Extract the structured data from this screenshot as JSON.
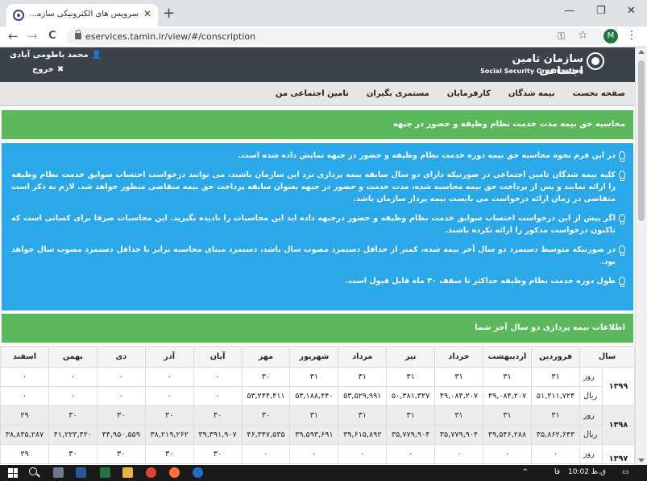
{
  "browser": {
    "tab_title": "سرویس های الکترونیکی سازمان تام",
    "tab_close": "✕",
    "new_tab": "+",
    "win_min": "—",
    "win_max": "❐",
    "win_close": "✕",
    "nav_back": "←",
    "nav_forward": "→",
    "nav_reload": "C",
    "url": "eservices.tamin.ir/view/#/conscription",
    "key": "⚿",
    "star": "☆",
    "profile_initial": "M",
    "menu": "⋮"
  },
  "header": {
    "logo_fa": "سازمان تامین اجتماعی",
    "logo_en": "Social Security Organization",
    "user_name": "محمد باطومی آبادی",
    "user_icon": "👤",
    "logout_label": "خروج",
    "logout_icon": "✖"
  },
  "nav": {
    "items": [
      "صفحه نخست",
      "بیمه شدگان",
      "کارفرمایان",
      "مستمری بگیران",
      "تامین اجتماعی من"
    ]
  },
  "calc_header": "محاسبه حق بیمه مدت خدمت نظام وظیفه و حضور در جبهه",
  "info": {
    "items": [
      "در این فرم نحوه محاسبه حق بیمه دوره خدمت نظام وظیفه و حضور در جبهه نمایش داده شده است.",
      "کلیه بیمه شدگان تامین اجتماعی در صورتیکه دارای دو سال سابقه بیمه پردازی نزد این سازمان باشند، می توانند درخواست احتساب سوابق خدمت نظام وظیفه را ارائه نمایند و پس از پرداخت حق بیمه محاسبه شده، مدت خدمت و حضور در جبهه بعنوان سابقه پرداخت حق بیمه متقاضی منظور خواهد شد. لازم به ذکر است متقاضی در زمان ارائه درخواست می بایست بیمه پرداز سازمان باشد.",
      "اگر پیش از این درخواست احتساب سوابق خدمت نظام وظیفه و حضور درجبهه داده اید این محاسبات را نادیده بگیرید. این محاسبات صرفا برای کسانی است که تاکنون درخواست مذکور را ارائه نکرده باشند.",
      "در صورتیکه متوسط دستمزد دو سال آخر بیمه شده، کمتر از حداقل دستمزد مصوب سال باشد، دستمزد مبنای محاسبه برابر با حداقل دستمزد مصوب سال خواهد بود.",
      "طول دوره خدمت نظام وظیفه حداکثر تا سقف ۳۰ ماه قابل قبول است."
    ]
  },
  "history_header": "اطلاعات بیمه پردازی دو سال آخر شما",
  "table": {
    "year_header": "سال",
    "months": [
      "فروردین",
      "اردیبهشت",
      "خرداد",
      "تیر",
      "مرداد",
      "شهریور",
      "مهر",
      "آبان",
      "آذر",
      "دی",
      "بهمن",
      "اسفند"
    ],
    "unit_days": "روز",
    "unit_rial": "ریال",
    "years": [
      {
        "year": "۱۳۹۹",
        "days": [
          "۳۱",
          "۳۱",
          "۳۱",
          "۳۱",
          "۳۱",
          "۳۱",
          "۳۰",
          "۰",
          "۰",
          "۰",
          "۰",
          "۰"
        ],
        "rials": [
          "۵۱,۲۱۱,۷۲۴",
          "۴۹,۰۸۴,۲۰۷",
          "۴۹,۰۸۴,۲۰۷",
          "۵۰,۳۸۱,۳۲۷",
          "۵۳,۵۲۹,۹۹۱",
          "۵۳,۱۸۸,۴۴۰",
          "۵۳,۲۴۴,۴۱۱",
          "۰",
          "۰",
          "۰",
          "۰",
          "۰"
        ]
      },
      {
        "year": "۱۳۹۸",
        "days": [
          "۳۱",
          "۳۱",
          "۳۱",
          "۳۱",
          "۳۱",
          "۳۱",
          "۳۰",
          "۳۰",
          "۳۰",
          "۳۰",
          "۳۰",
          "۲۹"
        ],
        "rials": [
          "۳۵,۸۶۲,۶۴۳",
          "۳۹,۵۴۶,۲۸۸",
          "۳۵,۷۷۹,۹۰۴",
          "۳۵,۷۷۹,۹۰۴",
          "۳۹,۶۱۵,۸۹۲",
          "۳۹,۵۹۳,۶۹۱",
          "۴۶,۳۴۷,۵۳۵",
          "۳۹,۳۹۱,۹۰۷",
          "۳۸,۲۱۹,۲۶۲",
          "۴۴,۹۵۰,۵۵۹",
          "۴۱,۲۲۳,۴۲۰",
          "۳۸,۸۳۵,۲۸۷"
        ]
      },
      {
        "year": "۱۳۹۷",
        "days": [
          "۰",
          "۰",
          "۰",
          "۰",
          "۰",
          "۰",
          "۰",
          "۳۰",
          "۳۰",
          "۳۰",
          "۳۰",
          "۲۹"
        ]
      }
    ]
  },
  "taskbar": {
    "lang": "فا",
    "date_time": "ق.ظ 10:02",
    "notif": "▭"
  }
}
